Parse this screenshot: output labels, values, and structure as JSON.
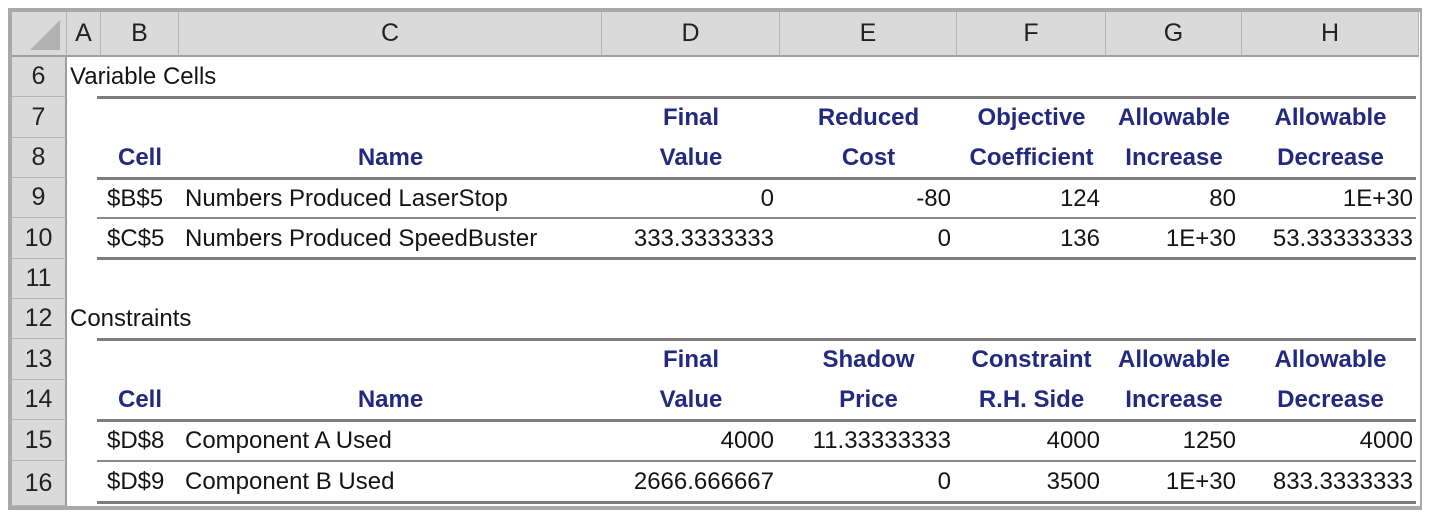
{
  "columns": [
    "A",
    "B",
    "C",
    "D",
    "E",
    "F",
    "G",
    "H"
  ],
  "rows": [
    "6",
    "7",
    "8",
    "9",
    "10",
    "11",
    "12",
    "13",
    "14",
    "15",
    "16"
  ],
  "variable_cells": {
    "title": "Variable Cells",
    "headers": {
      "cell": "Cell",
      "name": "Name",
      "final_value": [
        "Final",
        "Value"
      ],
      "reduced_cost": [
        "Reduced",
        "Cost"
      ],
      "objective_coefficient": [
        "Objective",
        "Coefficient"
      ],
      "allowable_increase": [
        "Allowable",
        "Increase"
      ],
      "allowable_decrease": [
        "Allowable",
        "Decrease"
      ]
    },
    "rows": [
      {
        "cell": "$B$5",
        "name": "Numbers Produced LaserStop",
        "final_value": "0",
        "reduced_cost": "-80",
        "objective_coefficient": "124",
        "allowable_increase": "80",
        "allowable_decrease": "1E+30"
      },
      {
        "cell": "$C$5",
        "name": "Numbers Produced SpeedBuster",
        "final_value": "333.3333333",
        "reduced_cost": "0",
        "objective_coefficient": "136",
        "allowable_increase": "1E+30",
        "allowable_decrease": "53.33333333"
      }
    ]
  },
  "constraints": {
    "title": "Constraints",
    "headers": {
      "cell": "Cell",
      "name": "Name",
      "final_value": [
        "Final",
        "Value"
      ],
      "shadow_price": [
        "Shadow",
        "Price"
      ],
      "constraint_rhs": [
        "Constraint",
        "R.H. Side"
      ],
      "allowable_increase": [
        "Allowable",
        "Increase"
      ],
      "allowable_decrease": [
        "Allowable",
        "Decrease"
      ]
    },
    "rows": [
      {
        "cell": "$D$8",
        "name": "Component A Used",
        "final_value": "4000",
        "shadow_price": "11.33333333",
        "constraint_rhs": "4000",
        "allowable_increase": "1250",
        "allowable_decrease": "4000"
      },
      {
        "cell": "$D$9",
        "name": "Component B Used",
        "final_value": "2666.666667",
        "shadow_price": "0",
        "constraint_rhs": "3500",
        "allowable_increase": "1E+30",
        "allowable_decrease": "833.3333333"
      }
    ]
  }
}
